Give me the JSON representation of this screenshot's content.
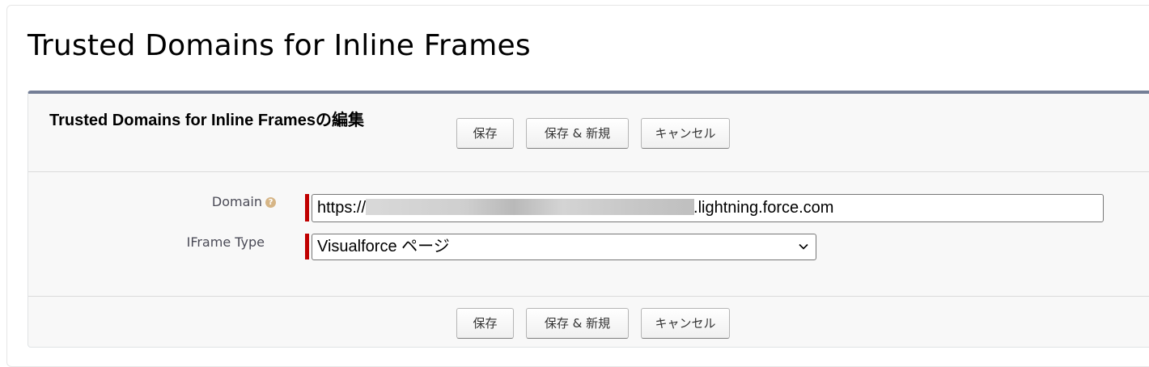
{
  "page": {
    "title": "Trusted Domains for Inline Frames"
  },
  "block": {
    "title": "Trusted Domains for Inline Framesの編集",
    "buttons": {
      "save": "保存",
      "save_new": "保存 & 新規",
      "cancel": "キャンセル"
    }
  },
  "fields": {
    "domain": {
      "label": "Domain",
      "value_prefix": "https://",
      "value_suffix": ".lightning.force.com",
      "required": true,
      "help_icon": "help-icon"
    },
    "iframe_type": {
      "label": "IFrame Type",
      "selected": "Visualforce ページ",
      "required": true
    }
  },
  "colors": {
    "header_accent": "#747e96",
    "required": "#c00000",
    "help_icon": "#d6b586"
  }
}
